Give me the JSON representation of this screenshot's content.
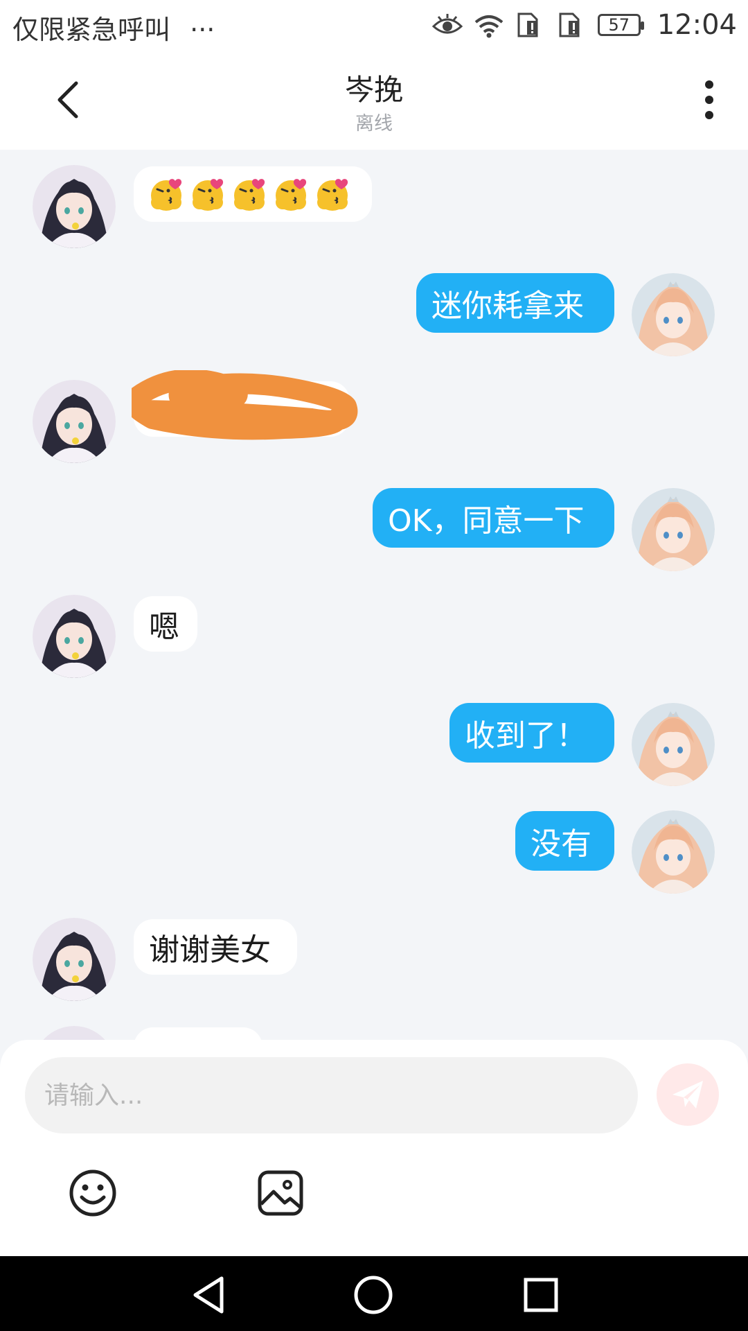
{
  "status_bar": {
    "carrier_text": "仅限紧急呼叫",
    "more": "···",
    "battery": "57",
    "time": "12:04"
  },
  "header": {
    "title": "岑挽",
    "subtitle": "离线"
  },
  "messages": [
    {
      "side": "left",
      "type": "emoji",
      "emoji_count": 5,
      "emoji_name": "kiss-heart-emoji"
    },
    {
      "side": "right",
      "text": "迷你耗拿来"
    },
    {
      "side": "left",
      "type": "scribbled",
      "text": ""
    },
    {
      "side": "right",
      "text": "OK，同意一下"
    },
    {
      "side": "left",
      "text": "嗯"
    },
    {
      "side": "right",
      "text": "收到了！"
    },
    {
      "side": "right",
      "text": "没有"
    },
    {
      "side": "left",
      "text": "谢谢美女"
    }
  ],
  "input": {
    "placeholder": "请输入..."
  },
  "icons": {
    "emoji_button": "smiley-icon",
    "image_button": "image-icon",
    "send_button": "paper-plane-icon"
  },
  "colors": {
    "self_bubble": "#22b0f5",
    "other_bubble": "#ffffff",
    "scribble": "#f0913e",
    "send_button_bg": "#ffe9e9"
  }
}
